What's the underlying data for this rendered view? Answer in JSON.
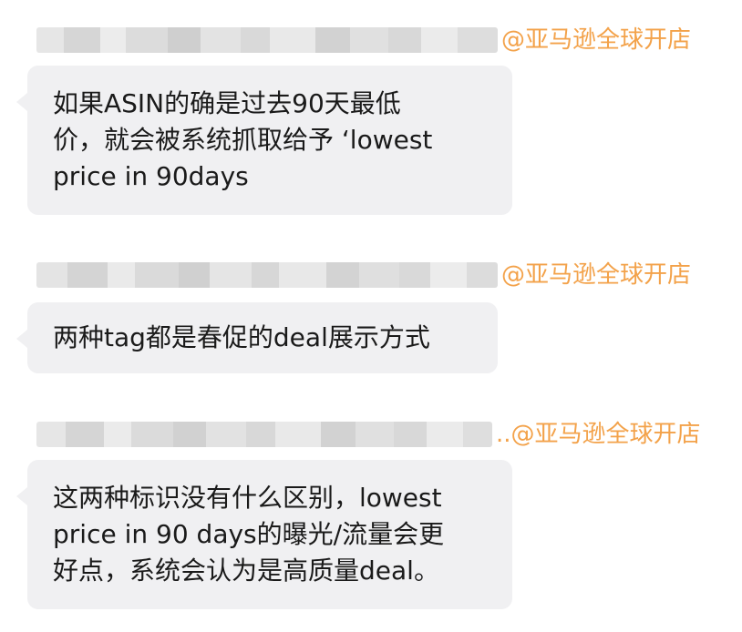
{
  "messages": [
    {
      "mention": "@亚马逊全球开店",
      "lines": [
        "如果ASIN的确是过去90天最低",
        "价，就会被系统抓取给予 ‘lowest",
        "price in 90days"
      ]
    },
    {
      "mention": "@亚马逊全球开店",
      "lines": [
        "两种tag都是春促的deal展示方式"
      ]
    },
    {
      "mention": "..@亚马逊全球开店",
      "lines": [
        "这两种标识没有什么区别，lowest",
        "price in 90 days的曝光/流量会更",
        "好点，系统会认为是高质量deal。"
      ]
    }
  ]
}
